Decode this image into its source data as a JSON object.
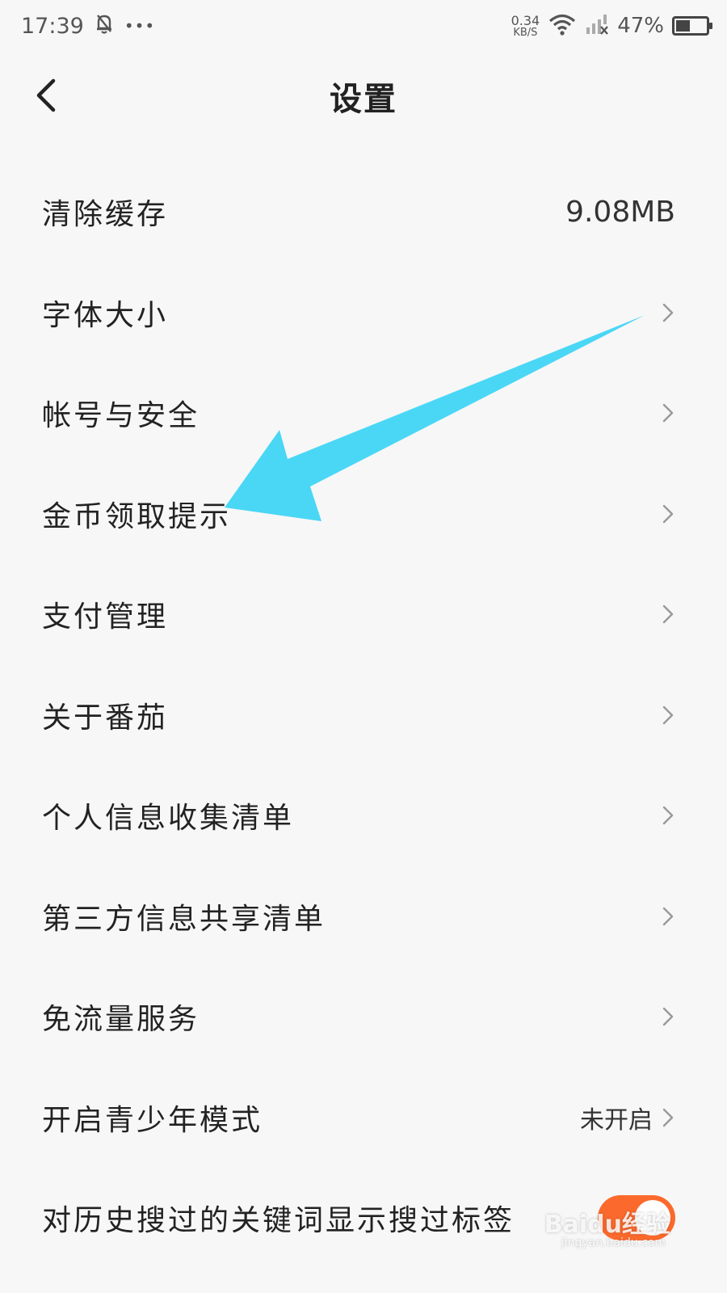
{
  "status_bar": {
    "time": "17:39",
    "more": "•••",
    "net_speed_value": "0.34",
    "net_speed_unit": "KB/S",
    "battery_percent": "47%",
    "battery_level": 0.47
  },
  "header": {
    "title": "设置",
    "back_icon": "chevron-left-icon"
  },
  "settings": {
    "items": [
      {
        "label": "清除缓存",
        "value": "9.08MB"
      },
      {
        "label": "字体大小"
      },
      {
        "label": "帐号与安全"
      },
      {
        "label": "金币领取提示"
      },
      {
        "label": "支付管理"
      },
      {
        "label": "关于番茄"
      },
      {
        "label": "个人信息收集清单"
      },
      {
        "label": "第三方信息共享清单"
      },
      {
        "label": "免流量服务"
      },
      {
        "label": "开启青少年模式",
        "value": "未开启"
      },
      {
        "label": "对历史搜过的关键词显示搜过标签",
        "toggle_on": true
      }
    ]
  },
  "annotation": {
    "color": "#4ad7f5"
  },
  "accent_color": "#fb6a2c",
  "watermark": {
    "text": "Baidu经验",
    "url": "jingyan.baidu.com"
  }
}
